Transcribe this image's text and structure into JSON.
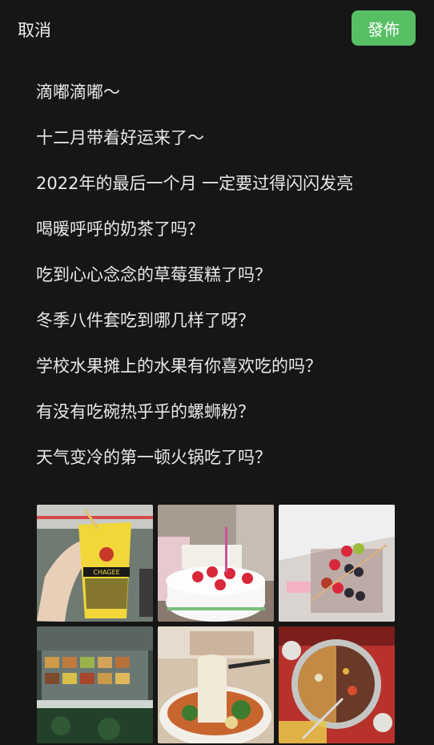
{
  "topbar": {
    "cancel_label": "取消",
    "publish_label": "發佈"
  },
  "post": {
    "lines": [
      "滴嘟滴嘟～",
      "十二月带着好运来了～",
      "2022年的最后一个月 一定要过得闪闪发亮",
      "喝暖呼呼的奶茶了吗？",
      "吃到心心念念的草莓蛋糕了吗？",
      "冬季八件套吃到哪几样了呀？",
      "学校水果摊上的水果有你喜欢吃的吗？",
      "有没有吃碗热乎乎的螺蛳粉？",
      "天气变冷的第一顿火锅吃了吗？"
    ]
  },
  "photos": {
    "cup_text": "CHAGEE",
    "items": [
      {
        "name": "milk-tea-photo"
      },
      {
        "name": "strawberry-cake-photo"
      },
      {
        "name": "fruit-skewers-photo"
      },
      {
        "name": "fruit-stall-photo"
      },
      {
        "name": "noodle-bowl-photo"
      },
      {
        "name": "hotpot-photo"
      }
    ]
  },
  "colors": {
    "background": "#161616",
    "accent": "#57c065",
    "text": "#e8e8e8"
  }
}
